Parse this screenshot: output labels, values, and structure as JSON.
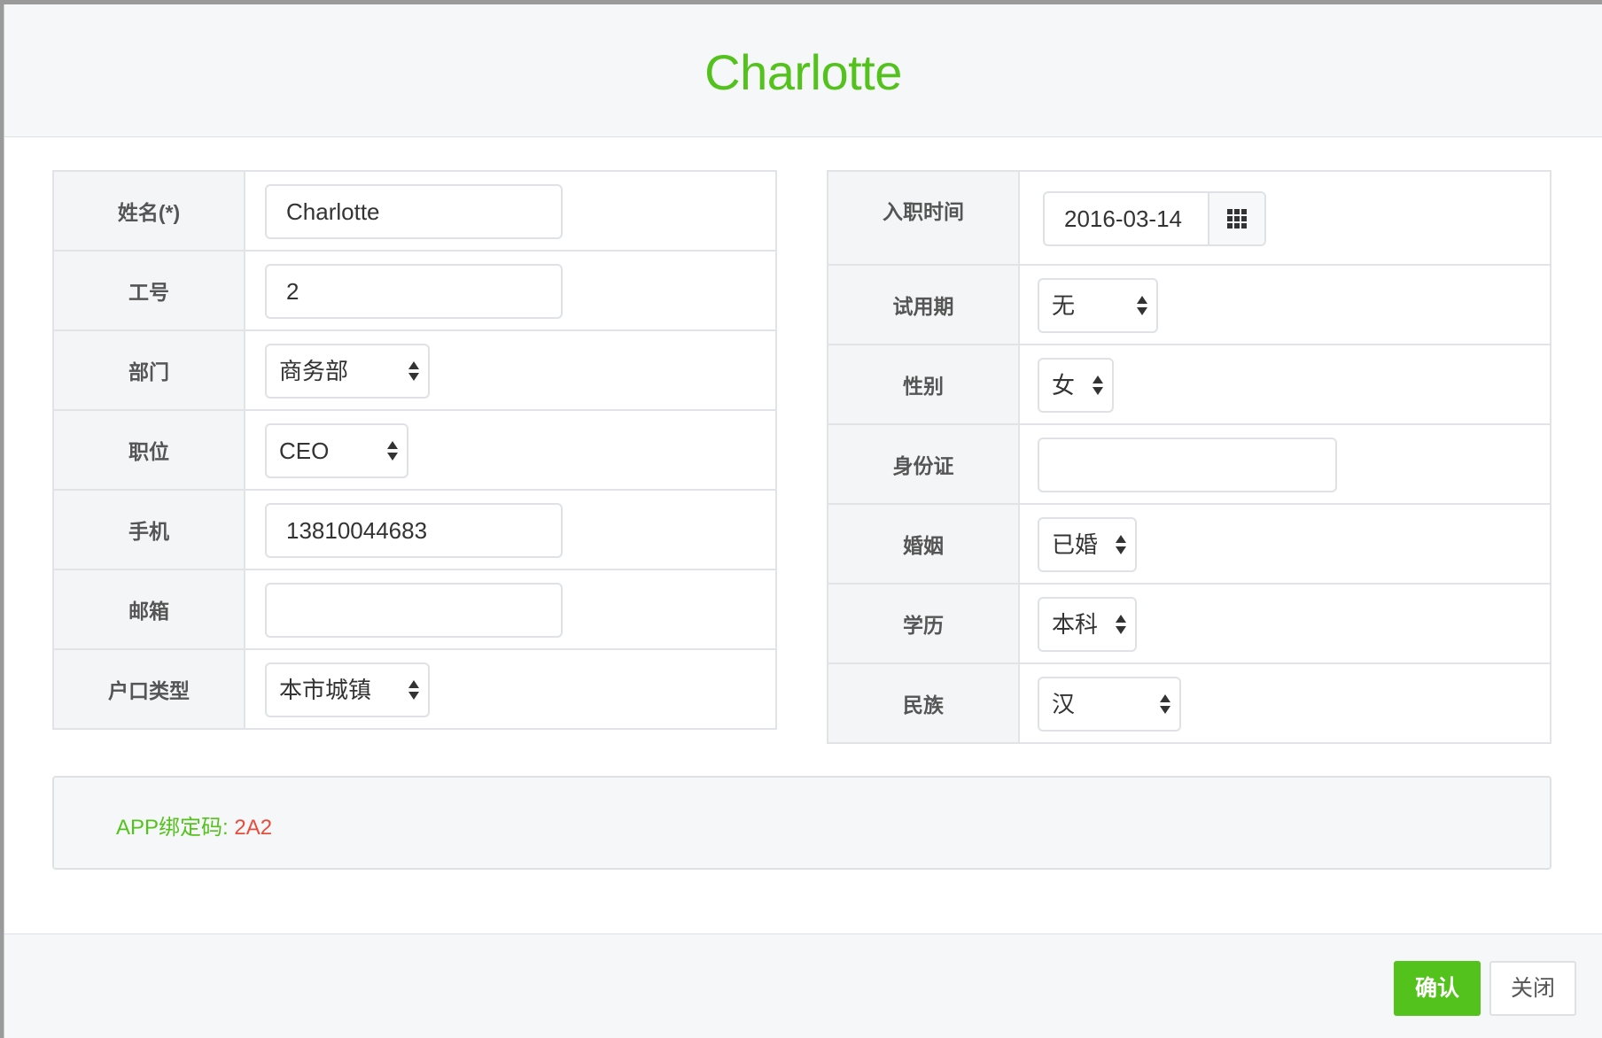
{
  "header": {
    "title": "Charlotte"
  },
  "left_form": {
    "name": {
      "label": "姓名(*)",
      "value": "Charlotte"
    },
    "employee_id": {
      "label": "工号",
      "value": "2"
    },
    "department": {
      "label": "部门",
      "value": "商务部"
    },
    "position": {
      "label": "职位",
      "value": "CEO"
    },
    "mobile": {
      "label": "手机",
      "value": "13810044683"
    },
    "email": {
      "label": "邮箱",
      "value": ""
    },
    "hukou_type": {
      "label": "户口类型",
      "value": "本市城镇"
    }
  },
  "right_form": {
    "hire_date": {
      "label": "入职时间",
      "value": "2016-03-14",
      "icon": "calendar-grid-icon"
    },
    "probation": {
      "label": "试用期",
      "value": "无"
    },
    "gender": {
      "label": "性别",
      "value": "女"
    },
    "id_card": {
      "label": "身份证",
      "value": ""
    },
    "marital": {
      "label": "婚姻",
      "value": "已婚"
    },
    "education": {
      "label": "学历",
      "value": "本科"
    },
    "ethnicity": {
      "label": "民族",
      "value": "汉"
    }
  },
  "app_binding": {
    "label": "APP绑定码: ",
    "code": "2A2"
  },
  "footer": {
    "confirm_label": "确认",
    "close_label": "关闭"
  },
  "colors": {
    "accent": "#54c21d",
    "code": "#e74c3c"
  }
}
